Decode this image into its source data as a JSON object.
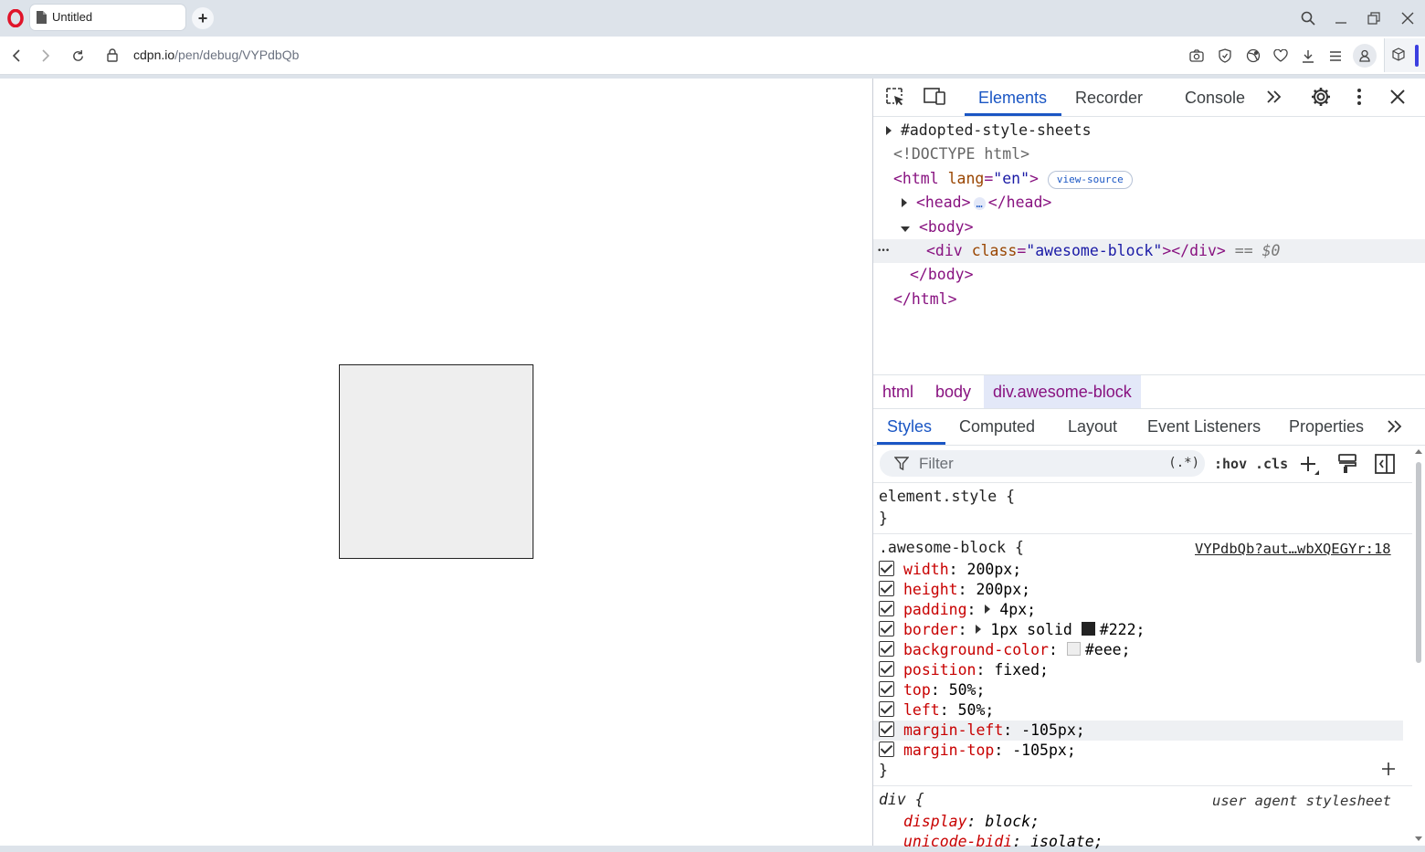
{
  "browser": {
    "tab_title": "Untitled",
    "url_host": "cdpn.io",
    "url_path": "/pen/debug/VYPdbQb"
  },
  "devtools": {
    "tabs": [
      "Elements",
      "Recorder",
      "Console"
    ],
    "dom": {
      "adopted": "#adopted-style-sheets",
      "doctype": "<!DOCTYPE html>",
      "html_open_tag": "<html",
      "html_attr": "lang",
      "html_attr_val": "\"en\"",
      "html_close_bracket": ">",
      "view_source": "view-source",
      "head_open": "<head>",
      "head_ellipsis": "…",
      "head_close": "</head>",
      "body_open": "<body>",
      "div_open": "<div",
      "div_attr": "class",
      "div_attr_val": "\"awesome-block\"",
      "div_close": "></div>",
      "selected_marker": "== $0",
      "body_close": "</body>",
      "html_close": "</html>",
      "row_dots": "•••"
    },
    "breadcrumbs": [
      "html",
      "body",
      "div.awesome-block"
    ],
    "subtabs": [
      "Styles",
      "Computed",
      "Layout",
      "Event Listeners",
      "Properties"
    ],
    "filter_placeholder": "Filter",
    "filter_tools": {
      "regex": "(.*)",
      "hov": ":hov",
      "cls": ".cls"
    },
    "styles": {
      "element_style_open": "element.style {",
      "close_brace": "}",
      "rule_selector": ".awesome-block {",
      "rule_source": "VYPdbQb?aut…wbXQEGYr:18",
      "declarations": [
        {
          "prop": "width",
          "value": "200px;"
        },
        {
          "prop": "height",
          "value": "200px;"
        },
        {
          "prop": "padding",
          "value": "4px;"
        },
        {
          "prop": "border",
          "value_a": "1px solid",
          "value_b": "#222;",
          "swatch": "#222222"
        },
        {
          "prop": "background-color",
          "value": "#eee;",
          "swatch": "#eeeeee"
        },
        {
          "prop": "position",
          "value": "fixed;"
        },
        {
          "prop": "top",
          "value": "50%;"
        },
        {
          "prop": "left",
          "value": "50%;"
        },
        {
          "prop": "margin-left",
          "value": "-105px;"
        },
        {
          "prop": "margin-top",
          "value": "-105px;"
        }
      ],
      "ua_selector": "div {",
      "ua_source": "user agent stylesheet",
      "ua_decls": [
        {
          "prop": "display",
          "value": "block;"
        },
        {
          "prop": "unicode-bidi",
          "value": "isolate;"
        }
      ]
    }
  },
  "colors": {
    "accent": "#1a56c4",
    "tag": "#881280",
    "property": "#c80000",
    "block_bg": "#eeeeee",
    "block_border": "#222222"
  }
}
